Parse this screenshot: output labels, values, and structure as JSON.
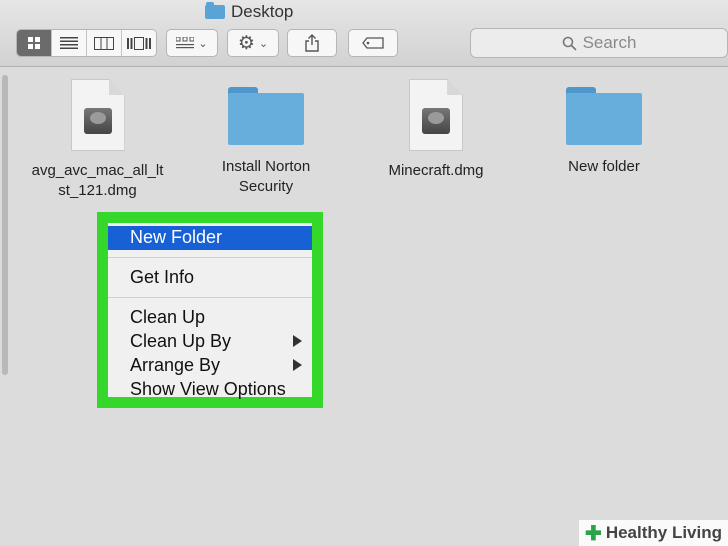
{
  "window": {
    "title": "Desktop"
  },
  "toolbar": {
    "view_buttons": [
      "icon-view-icon",
      "list-view-icon",
      "column-view-icon",
      "coverflow-view-icon"
    ],
    "arrange_icon": "arrange-icon",
    "action_icon": "gear-icon",
    "share_icon": "share-icon",
    "tag_icon": "tag-icon"
  },
  "search": {
    "placeholder": "Search"
  },
  "files": [
    {
      "line1": "avg_avc_mac_all_lt",
      "line2": "st_121.dmg",
      "kind": "dmg"
    },
    {
      "line1": "Install Norton",
      "line2": "Security",
      "kind": "folder"
    },
    {
      "line1": "Minecraft.dmg",
      "line2": "",
      "kind": "dmg"
    },
    {
      "line1": "New folder",
      "line2": "",
      "kind": "folder"
    }
  ],
  "context_menu": {
    "new_folder": "New Folder",
    "get_info": "Get Info",
    "clean_up": "Clean Up",
    "clean_up_by": "Clean Up By",
    "arrange_by": "Arrange By",
    "show_view_options": "Show View Options"
  },
  "watermark": {
    "text": "Healthy Living"
  },
  "colors": {
    "highlight": "#35d72a",
    "selection": "#1760d6",
    "folder": "#68aedc"
  }
}
